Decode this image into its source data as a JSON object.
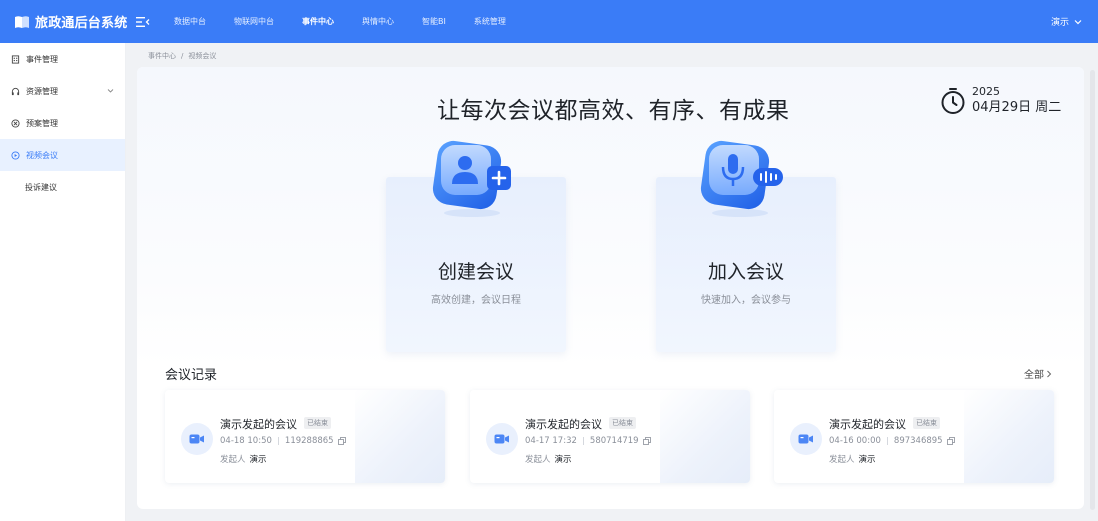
{
  "header": {
    "app_title": "旅政通后台系统",
    "nav": [
      {
        "label": "数据中台",
        "active": false
      },
      {
        "label": "物联网中台",
        "active": false
      },
      {
        "label": "事件中心",
        "active": true
      },
      {
        "label": "舆情中心",
        "active": false
      },
      {
        "label": "智能BI",
        "active": false
      },
      {
        "label": "系统管理",
        "active": false
      }
    ],
    "user_name": "演示",
    "accent_color": "#3a7cf7"
  },
  "sidebar": {
    "items": [
      {
        "label": "事件管理",
        "icon": "building-icon",
        "active": false
      },
      {
        "label": "资源管理",
        "icon": "headset-icon",
        "active": false,
        "expandable": true
      },
      {
        "label": "预案管理",
        "icon": "target-icon",
        "active": false
      },
      {
        "label": "视频会议",
        "icon": "video-icon",
        "active": true
      },
      {
        "label": "投诉建议",
        "active": false
      }
    ]
  },
  "breadcrumb": {
    "items": [
      "事件中心",
      "视频会议"
    ],
    "separator": "/"
  },
  "main": {
    "slogan": "让每次会议都高效、有序、有成果",
    "year": "2025",
    "date": "04月29日 周二",
    "actions": [
      {
        "title": "创建会议",
        "subtitle": "高效创建，会议日程",
        "icon": "user-add-icon"
      },
      {
        "title": "加入会议",
        "subtitle": "快速加入，会议参与",
        "icon": "microphone-icon"
      }
    ]
  },
  "records": {
    "title": "会议记录",
    "all_label": "全部",
    "items": [
      {
        "title": "演示发起的会议",
        "status": "已结束",
        "time": "04-18 10:50",
        "meeting_id": "119288865",
        "host_label": "发起人",
        "host": "演示"
      },
      {
        "title": "演示发起的会议",
        "status": "已结束",
        "time": "04-17 17:32",
        "meeting_id": "580714719",
        "host_label": "发起人",
        "host": "演示"
      },
      {
        "title": "演示发起的会议",
        "status": "已结束",
        "time": "04-16 00:00",
        "meeting_id": "897346895",
        "host_label": "发起人",
        "host": "演示"
      }
    ]
  }
}
